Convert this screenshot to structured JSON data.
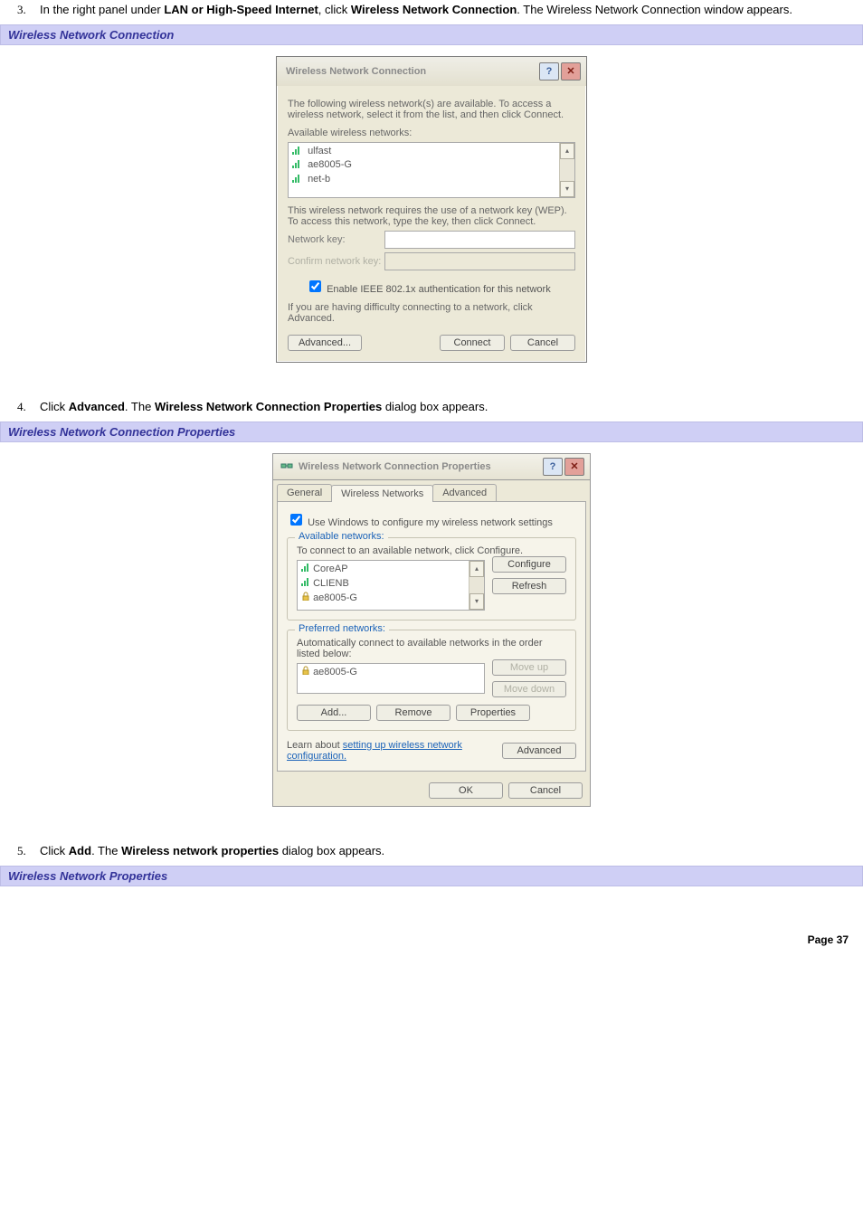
{
  "step3": {
    "num": "3.",
    "prefix": "In the right panel under ",
    "bold1": "LAN or High-Speed Internet",
    "mid": ", click ",
    "bold2": "Wireless Network Connection",
    "suffix": ". The Wireless Network Connection window appears."
  },
  "head1": "Wireless Network Connection",
  "dialog1": {
    "title": "Wireless Network Connection",
    "desc": "The following wireless network(s) are available. To access a wireless network, select it from the list, and then click Connect.",
    "avail_label": "Available wireless networks:",
    "items": [
      "ulfast",
      "ae8005-G",
      "net-b"
    ],
    "wep_text": "This wireless network requires the use of a network key (WEP). To access this network, type the key, then click Connect.",
    "netkey_label": "Network key:",
    "confirm_label": "Confirm network key:",
    "enable_8021x": "Enable IEEE 802.1x authentication for this network",
    "difficulty": "If you are having difficulty connecting to a network, click Advanced.",
    "btn_advanced": "Advanced...",
    "btn_connect": "Connect",
    "btn_cancel": "Cancel"
  },
  "step4": {
    "num": "4.",
    "prefix": "Click ",
    "bold1": "Advanced",
    "mid": ". The ",
    "bold2": "Wireless Network Connection Properties",
    "suffix": " dialog box appears."
  },
  "head2": "Wireless Network Connection Properties",
  "dialog2": {
    "title": "Wireless Network Connection Properties",
    "tabs": {
      "general": "General",
      "wireless": "Wireless Networks",
      "advanced": "Advanced"
    },
    "use_windows": "Use Windows to configure my wireless network settings",
    "avail_legend": "Available networks:",
    "avail_hint": "To connect to an available network, click Configure.",
    "avail_items": [
      "CoreAP",
      "CLIENB",
      "ae8005-G"
    ],
    "btn_configure": "Configure",
    "btn_refresh": "Refresh",
    "pref_legend": "Preferred networks:",
    "pref_hint": "Automatically connect to available networks in the order listed below:",
    "pref_items": [
      "ae8005-G"
    ],
    "btn_moveup": "Move up",
    "btn_movedown": "Move down",
    "btn_add": "Add...",
    "btn_remove": "Remove",
    "btn_properties": "Properties",
    "learn_prefix": "Learn about ",
    "learn_link": "setting up wireless network configuration.",
    "btn_advanced": "Advanced",
    "btn_ok": "OK",
    "btn_cancel": "Cancel"
  },
  "step5": {
    "num": "5.",
    "prefix": "Click ",
    "bold1": "Add",
    "mid": ". The ",
    "bold2": "Wireless network properties",
    "suffix": " dialog box appears."
  },
  "head3": "Wireless Network Properties",
  "page_footer": "Page 37"
}
